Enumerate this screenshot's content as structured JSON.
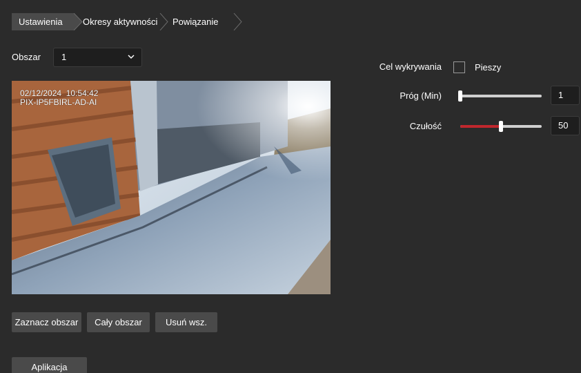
{
  "tabs": [
    {
      "label": "Ustawienia",
      "active": true
    },
    {
      "label": "Okresy aktywności",
      "active": false
    },
    {
      "label": "Powiązanie",
      "active": false
    }
  ],
  "area": {
    "label": "Obszar",
    "selected": "1"
  },
  "video": {
    "timestamp": "02/12/2024  10:54:42",
    "camera_name": "PIX-IP5FBIRL-AD-AI"
  },
  "buttons": {
    "mark_area": "Zaznacz obszar",
    "full_area": "Cały obszar",
    "clear_all": "Usuń wsz.",
    "apply": "Aplikacja"
  },
  "detection": {
    "target_label": "Cel wykrywania",
    "pedestrian_label": "Pieszy",
    "pedestrian_checked": false,
    "threshold_label": "Próg (Min)",
    "threshold_value": "1",
    "threshold_fraction": 0.0,
    "sensitivity_label": "Czułość",
    "sensitivity_value": "50",
    "sensitivity_fraction": 0.5
  },
  "colors": {
    "background": "#2b2b2b",
    "active_tab": "#4a4a4a",
    "slider_fill": "#c0272d"
  },
  "icons": {
    "dropdown": "chevron-down-icon",
    "tab_separator": "chevron-right-icon"
  }
}
